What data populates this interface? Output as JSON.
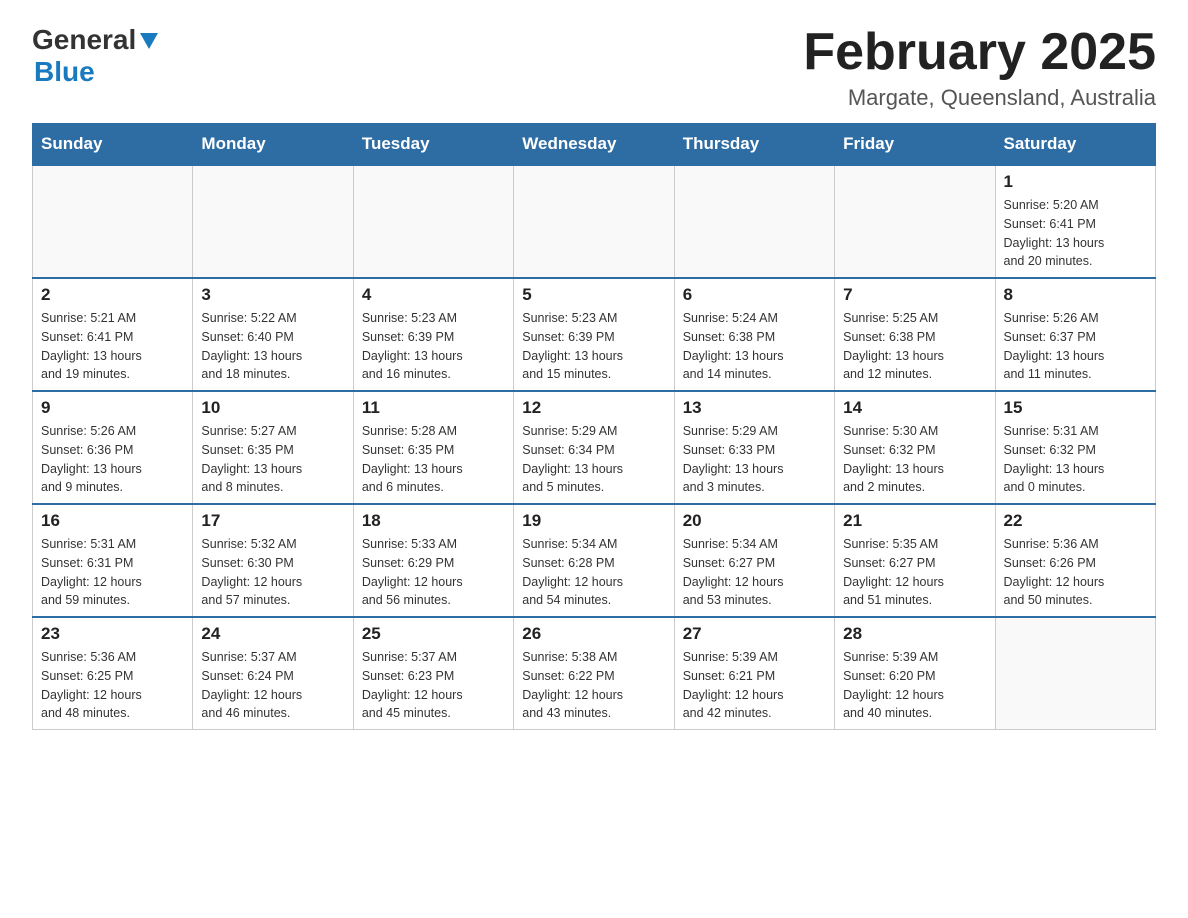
{
  "header": {
    "logo_general": "General",
    "logo_blue": "Blue",
    "month": "February 2025",
    "location": "Margate, Queensland, Australia"
  },
  "weekdays": [
    "Sunday",
    "Monday",
    "Tuesday",
    "Wednesday",
    "Thursday",
    "Friday",
    "Saturday"
  ],
  "weeks": [
    [
      {
        "day": "",
        "info": ""
      },
      {
        "day": "",
        "info": ""
      },
      {
        "day": "",
        "info": ""
      },
      {
        "day": "",
        "info": ""
      },
      {
        "day": "",
        "info": ""
      },
      {
        "day": "",
        "info": ""
      },
      {
        "day": "1",
        "info": "Sunrise: 5:20 AM\nSunset: 6:41 PM\nDaylight: 13 hours\nand 20 minutes."
      }
    ],
    [
      {
        "day": "2",
        "info": "Sunrise: 5:21 AM\nSunset: 6:41 PM\nDaylight: 13 hours\nand 19 minutes."
      },
      {
        "day": "3",
        "info": "Sunrise: 5:22 AM\nSunset: 6:40 PM\nDaylight: 13 hours\nand 18 minutes."
      },
      {
        "day": "4",
        "info": "Sunrise: 5:23 AM\nSunset: 6:39 PM\nDaylight: 13 hours\nand 16 minutes."
      },
      {
        "day": "5",
        "info": "Sunrise: 5:23 AM\nSunset: 6:39 PM\nDaylight: 13 hours\nand 15 minutes."
      },
      {
        "day": "6",
        "info": "Sunrise: 5:24 AM\nSunset: 6:38 PM\nDaylight: 13 hours\nand 14 minutes."
      },
      {
        "day": "7",
        "info": "Sunrise: 5:25 AM\nSunset: 6:38 PM\nDaylight: 13 hours\nand 12 minutes."
      },
      {
        "day": "8",
        "info": "Sunrise: 5:26 AM\nSunset: 6:37 PM\nDaylight: 13 hours\nand 11 minutes."
      }
    ],
    [
      {
        "day": "9",
        "info": "Sunrise: 5:26 AM\nSunset: 6:36 PM\nDaylight: 13 hours\nand 9 minutes."
      },
      {
        "day": "10",
        "info": "Sunrise: 5:27 AM\nSunset: 6:35 PM\nDaylight: 13 hours\nand 8 minutes."
      },
      {
        "day": "11",
        "info": "Sunrise: 5:28 AM\nSunset: 6:35 PM\nDaylight: 13 hours\nand 6 minutes."
      },
      {
        "day": "12",
        "info": "Sunrise: 5:29 AM\nSunset: 6:34 PM\nDaylight: 13 hours\nand 5 minutes."
      },
      {
        "day": "13",
        "info": "Sunrise: 5:29 AM\nSunset: 6:33 PM\nDaylight: 13 hours\nand 3 minutes."
      },
      {
        "day": "14",
        "info": "Sunrise: 5:30 AM\nSunset: 6:32 PM\nDaylight: 13 hours\nand 2 minutes."
      },
      {
        "day": "15",
        "info": "Sunrise: 5:31 AM\nSunset: 6:32 PM\nDaylight: 13 hours\nand 0 minutes."
      }
    ],
    [
      {
        "day": "16",
        "info": "Sunrise: 5:31 AM\nSunset: 6:31 PM\nDaylight: 12 hours\nand 59 minutes."
      },
      {
        "day": "17",
        "info": "Sunrise: 5:32 AM\nSunset: 6:30 PM\nDaylight: 12 hours\nand 57 minutes."
      },
      {
        "day": "18",
        "info": "Sunrise: 5:33 AM\nSunset: 6:29 PM\nDaylight: 12 hours\nand 56 minutes."
      },
      {
        "day": "19",
        "info": "Sunrise: 5:34 AM\nSunset: 6:28 PM\nDaylight: 12 hours\nand 54 minutes."
      },
      {
        "day": "20",
        "info": "Sunrise: 5:34 AM\nSunset: 6:27 PM\nDaylight: 12 hours\nand 53 minutes."
      },
      {
        "day": "21",
        "info": "Sunrise: 5:35 AM\nSunset: 6:27 PM\nDaylight: 12 hours\nand 51 minutes."
      },
      {
        "day": "22",
        "info": "Sunrise: 5:36 AM\nSunset: 6:26 PM\nDaylight: 12 hours\nand 50 minutes."
      }
    ],
    [
      {
        "day": "23",
        "info": "Sunrise: 5:36 AM\nSunset: 6:25 PM\nDaylight: 12 hours\nand 48 minutes."
      },
      {
        "day": "24",
        "info": "Sunrise: 5:37 AM\nSunset: 6:24 PM\nDaylight: 12 hours\nand 46 minutes."
      },
      {
        "day": "25",
        "info": "Sunrise: 5:37 AM\nSunset: 6:23 PM\nDaylight: 12 hours\nand 45 minutes."
      },
      {
        "day": "26",
        "info": "Sunrise: 5:38 AM\nSunset: 6:22 PM\nDaylight: 12 hours\nand 43 minutes."
      },
      {
        "day": "27",
        "info": "Sunrise: 5:39 AM\nSunset: 6:21 PM\nDaylight: 12 hours\nand 42 minutes."
      },
      {
        "day": "28",
        "info": "Sunrise: 5:39 AM\nSunset: 6:20 PM\nDaylight: 12 hours\nand 40 minutes."
      },
      {
        "day": "",
        "info": ""
      }
    ]
  ]
}
